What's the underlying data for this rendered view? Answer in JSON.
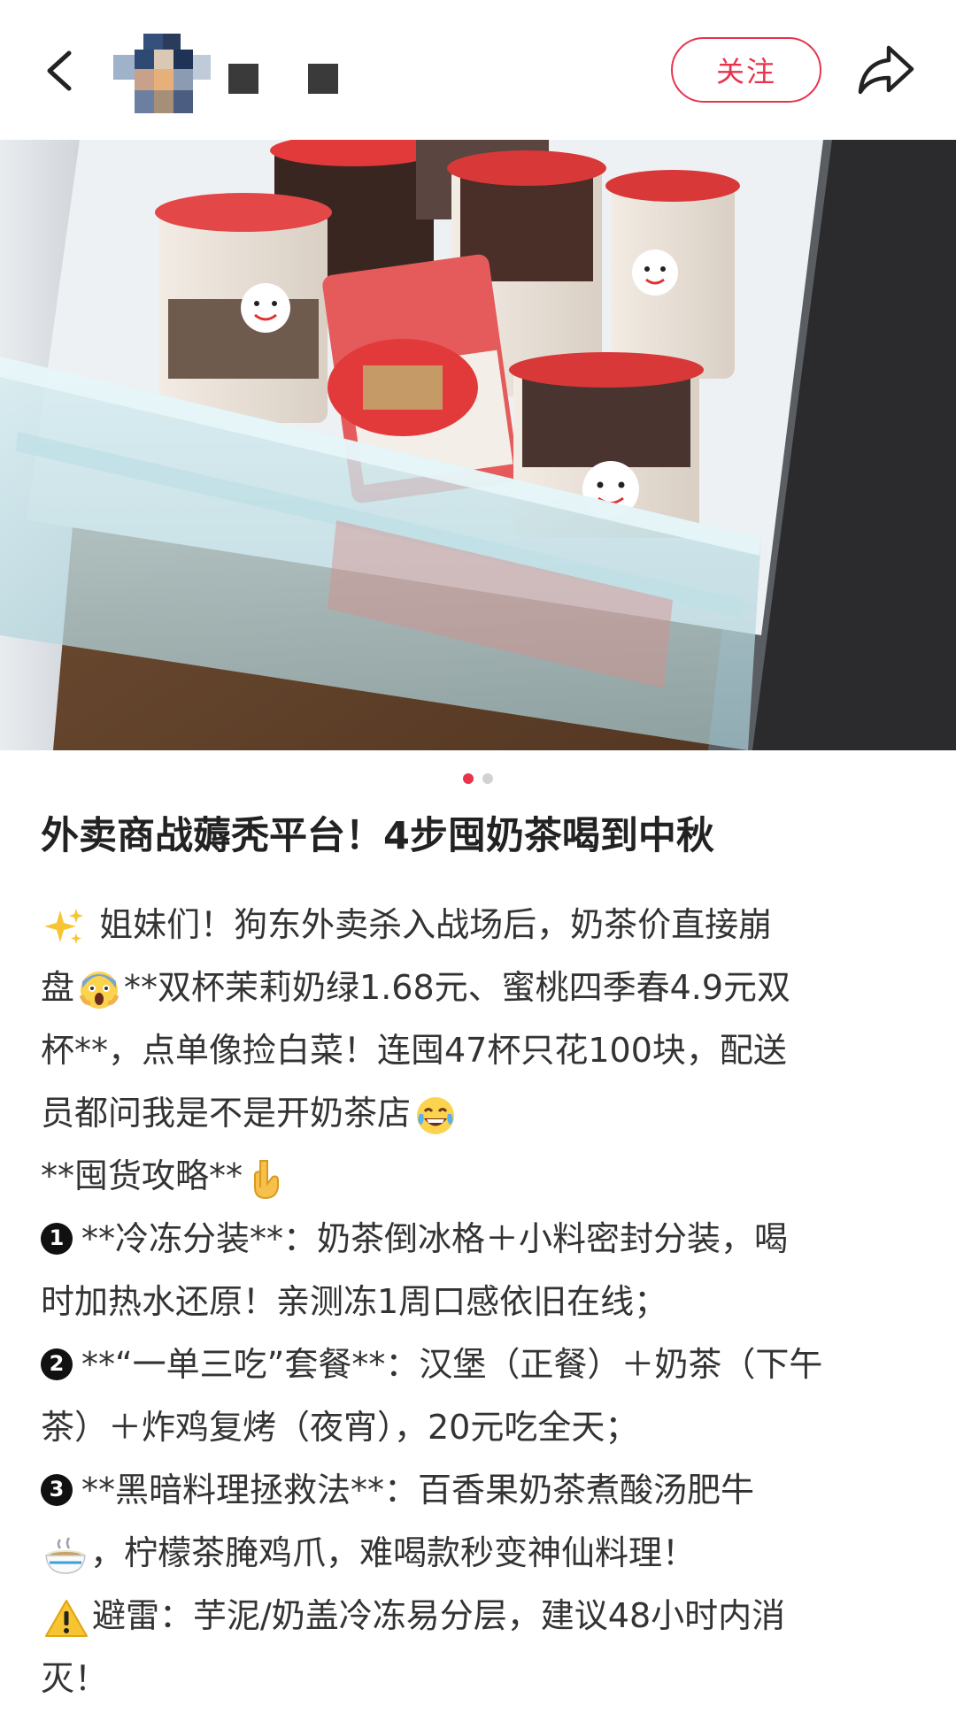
{
  "header": {
    "follow_label": "关注"
  },
  "pagination": {
    "total": 2,
    "active": 1
  },
  "post": {
    "title": "外卖商战薅秃平台！4步囤奶茶喝到中秋",
    "paragraph1": {
      "line1": "姐妹们！狗东外卖杀入战场后，奶茶价直接崩",
      "line2_prefix": "盘",
      "line2_suffix": "**双杯茉莉奶绿1.68元、蜜桃四季春4.9元双",
      "line3": "杯**，点单像捡白菜！连囤47杯只花100块，配送",
      "line4": "员都问我是不是开奶茶店"
    },
    "strategy_heading": "**囤货攻略**",
    "step1": {
      "number": "1",
      "line1": "**冷冻分装**：奶茶倒冰格＋小料密封分装，喝",
      "line2": "时加热水还原！亲测冻1周口感依旧在线；"
    },
    "step2": {
      "number": "2",
      "line1": "**“一单三吃”套餐**：汉堡（正餐）＋奶茶（下午",
      "line2": "茶）＋炸鸡复烤（夜宵），20元吃全天；"
    },
    "step3": {
      "number": "3",
      "line1": "**黑暗料理拯救法**：百香果奶茶煮酸汤肥牛",
      "line2": "，柠檬茶腌鸡爪，难喝款秒变神仙料理！"
    },
    "warning": {
      "line1": "避雷：芋泥/奶盖冷冻易分层，建议48小时内消",
      "line2": "灭！"
    }
  },
  "icons": {
    "back": "chevron-left-icon",
    "share": "share-arrow-icon",
    "sparkles": "sparkles-emoji",
    "scream": "screaming-face-emoji",
    "joy": "tears-of-joy-emoji",
    "point_down": "backhand-index-pointing-down-emoji",
    "soup": "soup-bowl-emoji",
    "warning": "warning-sign-emoji"
  },
  "colors": {
    "accent": "#e8334d",
    "text": "#333333",
    "title": "#222222"
  }
}
